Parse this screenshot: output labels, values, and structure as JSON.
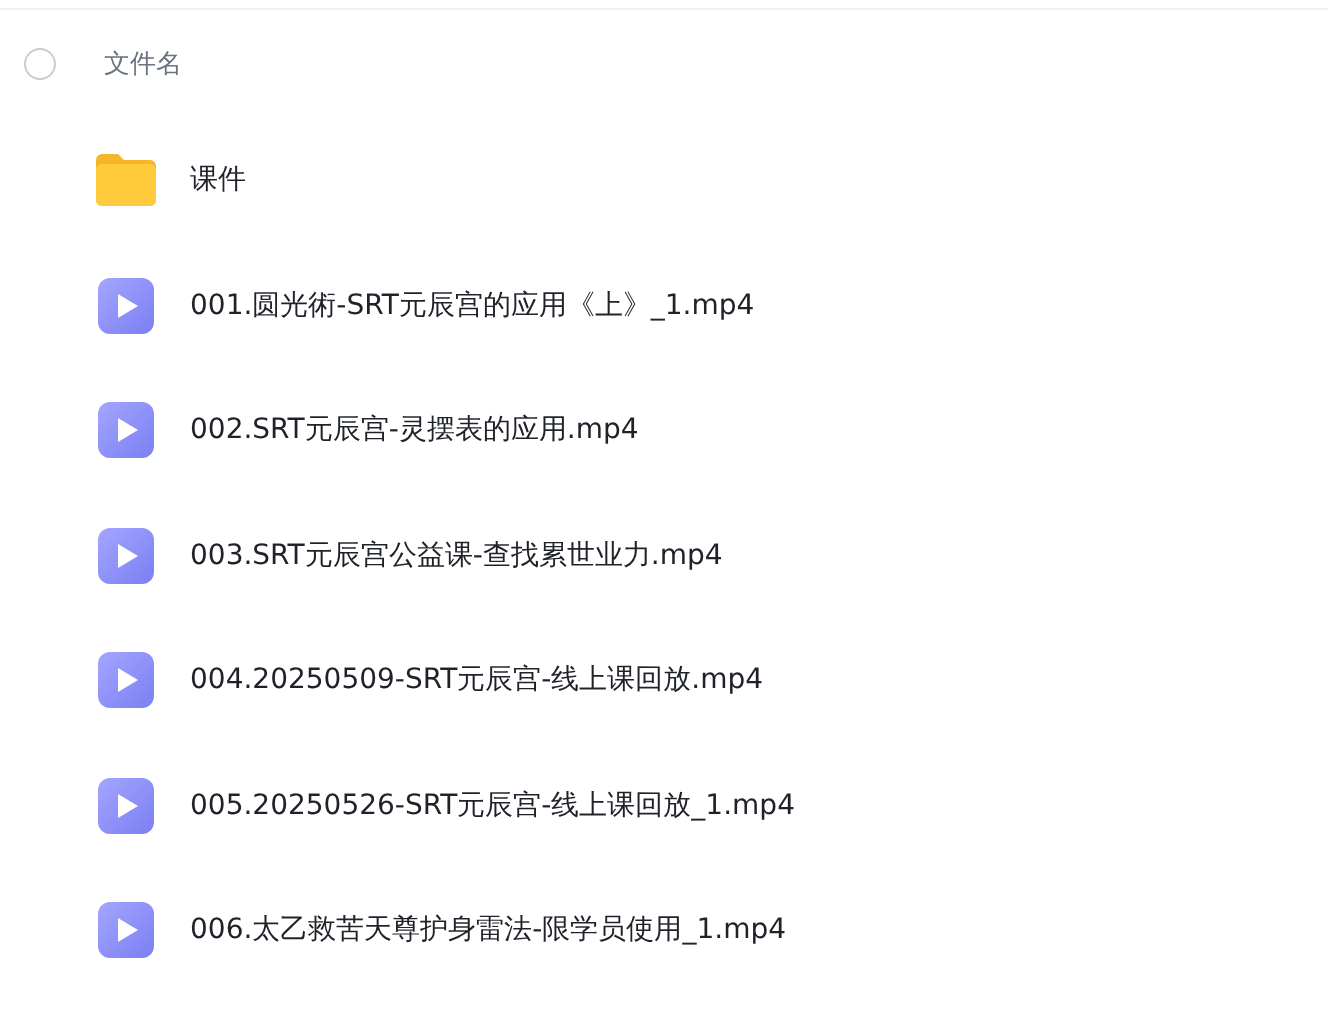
{
  "header": {
    "label": "文件名",
    "checked": false
  },
  "files": [
    {
      "kind": "folder",
      "name": "课件"
    },
    {
      "kind": "video",
      "name": "001.圆光術-SRT元辰宫的应用《上》_1.mp4"
    },
    {
      "kind": "video",
      "name": "002.SRT元辰宫-灵摆表的应用.mp4"
    },
    {
      "kind": "video",
      "name": "003.SRT元辰宫公益课-查找累世业力.mp4"
    },
    {
      "kind": "video",
      "name": "004.20250509-SRT元辰宫-线上课回放.mp4"
    },
    {
      "kind": "video",
      "name": "005.20250526-SRT元辰宫-线上课回放_1.mp4"
    },
    {
      "kind": "video",
      "name": "006.太乙救苦天尊护身雷法-限学员使用_1.mp4"
    }
  ]
}
